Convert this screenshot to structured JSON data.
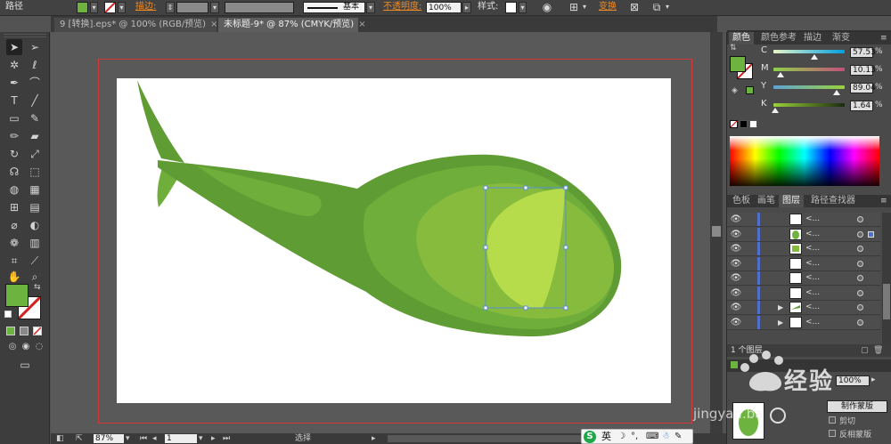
{
  "control_bar": {
    "object_type": "路径",
    "stroke_label": "描边:",
    "brush_label": "基本",
    "opacity_label": "不透明度:",
    "opacity_value": "100%",
    "style_label": "样式:",
    "transform_label": "变换",
    "fill_color": "#6db33f"
  },
  "tabs": [
    {
      "label": "9 [转换].eps* @ 100% (RGB/预览)",
      "close": "×"
    },
    {
      "label": "未标题-9* @ 87% (CMYK/预览)",
      "close": "×"
    }
  ],
  "status": {
    "zoom": "87%",
    "page": "1",
    "tool_name": "选择"
  },
  "color_panel": {
    "tabs": [
      "颜色",
      "颜色参考",
      "描边",
      "渐变"
    ],
    "channels": [
      {
        "label": "C",
        "value": "57.53",
        "fraction": 0.58
      },
      {
        "label": "M",
        "value": "10.13",
        "fraction": 0.1
      },
      {
        "label": "Y",
        "value": "89.04",
        "fraction": 0.89
      },
      {
        "label": "K",
        "value": "1.64",
        "fraction": 0.02
      }
    ],
    "percent": "%",
    "fill_color": "#6db33f"
  },
  "layers_panel": {
    "tabs": [
      "色板",
      "画笔",
      "图层",
      "路径查找器"
    ],
    "layer_count": "1 个图层",
    "row_name": "<...",
    "rows": 8
  },
  "bottom_panel": {
    "opacity_value": "100%",
    "make_mask": "制作蒙版",
    "clip": "剪切",
    "invert_mask": "反相蒙版"
  },
  "ime": {
    "lang": "英"
  },
  "watermark": {
    "text": "经验",
    "url": "jingyan.ba"
  },
  "colors": {
    "leaf_dark": "#5f9c33",
    "leaf_mid": "#6fae3a",
    "leaf_light": "#86bb3e",
    "highlight": "#b7dc4b",
    "selection": "#5a8ed8",
    "artboard_border": "#d13a3a"
  },
  "icons": {
    "select": "selection-arrow-icon",
    "direct": "direct-selection-icon",
    "eye": "eye-icon"
  }
}
